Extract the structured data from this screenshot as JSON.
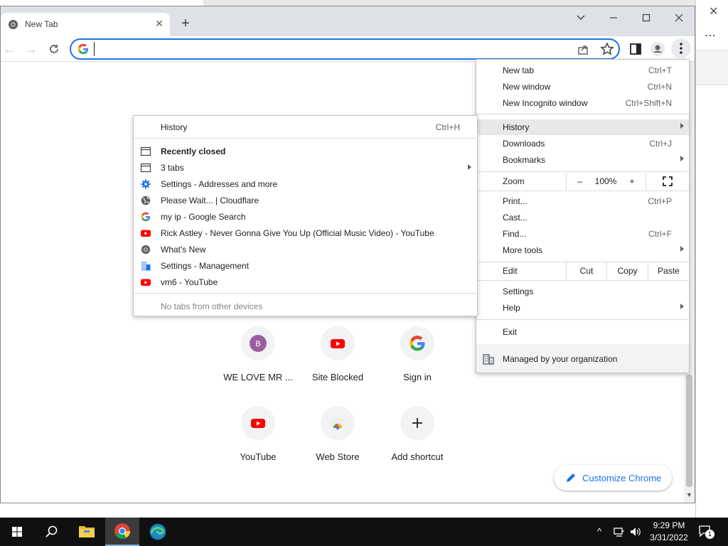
{
  "window": {
    "tab_title": "New Tab",
    "omnibox_value": "",
    "omnibox_placeholder": ""
  },
  "shortcuts": [
    {
      "label": "WE LOVE MR ...",
      "icon": "letter-b-avatar-icon",
      "letter": "B",
      "color": "#9c5ea0"
    },
    {
      "label": "Site Blocked",
      "icon": "youtube-icon"
    },
    {
      "label": "Sign in",
      "icon": "google-icon"
    },
    {
      "label": "YouTube",
      "icon": "youtube-icon"
    },
    {
      "label": "Web Store",
      "icon": "chrome-web-store-icon"
    },
    {
      "label": "Add shortcut",
      "icon": "plus-icon"
    }
  ],
  "customize_label": "Customize Chrome",
  "menu": {
    "new_tab": {
      "label": "New tab",
      "shortcut": "Ctrl+T"
    },
    "new_window": {
      "label": "New window",
      "shortcut": "Ctrl+N"
    },
    "new_incognito": {
      "label": "New Incognito window",
      "shortcut": "Ctrl+Shift+N"
    },
    "history": {
      "label": "History"
    },
    "downloads": {
      "label": "Downloads",
      "shortcut": "Ctrl+J"
    },
    "bookmarks": {
      "label": "Bookmarks"
    },
    "zoom": {
      "label": "Zoom",
      "minus": "–",
      "value": "100%",
      "plus": "+"
    },
    "print": {
      "label": "Print...",
      "shortcut": "Ctrl+P"
    },
    "cast": {
      "label": "Cast..."
    },
    "find": {
      "label": "Find...",
      "shortcut": "Ctrl+F"
    },
    "more_tools": {
      "label": "More tools"
    },
    "edit": {
      "label": "Edit",
      "cut": "Cut",
      "copy": "Copy",
      "paste": "Paste"
    },
    "settings": {
      "label": "Settings"
    },
    "help": {
      "label": "Help"
    },
    "exit": {
      "label": "Exit"
    },
    "managed": {
      "label": "Managed by your organization"
    }
  },
  "history_submenu": {
    "history": {
      "label": "History",
      "shortcut": "Ctrl+H"
    },
    "recently_closed": "Recently closed",
    "items": [
      {
        "label": "3 tabs",
        "icon": "tab-window-icon",
        "has_submenu": true
      },
      {
        "label": "Settings - Addresses and more",
        "icon": "settings-gear-icon"
      },
      {
        "label": "Please Wait... | Cloudflare",
        "icon": "globe-icon"
      },
      {
        "label": "my ip - Google Search",
        "icon": "google-icon"
      },
      {
        "label": "Rick Astley - Never Gonna Give You Up (Official Music Video) - YouTube",
        "icon": "youtube-icon"
      },
      {
        "label": "What's New",
        "icon": "chrome-icon"
      },
      {
        "label": "Settings - Management",
        "icon": "building-icon"
      },
      {
        "label": "vm6 - YouTube",
        "icon": "youtube-icon"
      }
    ],
    "no_devices": "No tabs from other devices"
  },
  "taskbar": {
    "time": "9:29 PM",
    "date": "3/31/2022",
    "notification_count": "1"
  },
  "colors": {
    "accent": "#1a73e8",
    "youtube_red": "#ff0000",
    "taskbar": "#101010"
  }
}
